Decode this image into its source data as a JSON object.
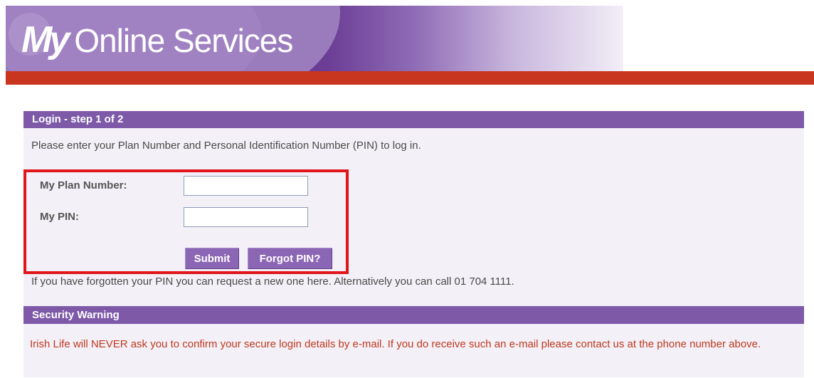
{
  "banner": {
    "title_my": "My",
    "title_rest": "Online Services"
  },
  "login": {
    "header": "Login - step 1 of 2",
    "intro": "Please enter your Plan Number and Personal Identification Number (PIN) to log in.",
    "plan_number_label": "My Plan Number:",
    "plan_number_value": "",
    "pin_label": "My PIN:",
    "pin_value": "",
    "submit_label": "Submit",
    "forgot_pin_label": "Forgot PIN?",
    "forgot_text": "If you have forgotten your PIN you can request a new one here. Alternatively you can call 01 704 1111."
  },
  "security": {
    "header": "Security Warning",
    "warning": "Irish Life will NEVER ask you to confirm your secure login details by e-mail. If you do receive such an e-mail please contact us at the phone number above."
  },
  "colors": {
    "purple_header": "#7d59a8",
    "button_purple": "#8b66b4",
    "red_bar": "#c9361f",
    "highlight_red": "#e0161a",
    "warning_text": "#c0391e"
  }
}
